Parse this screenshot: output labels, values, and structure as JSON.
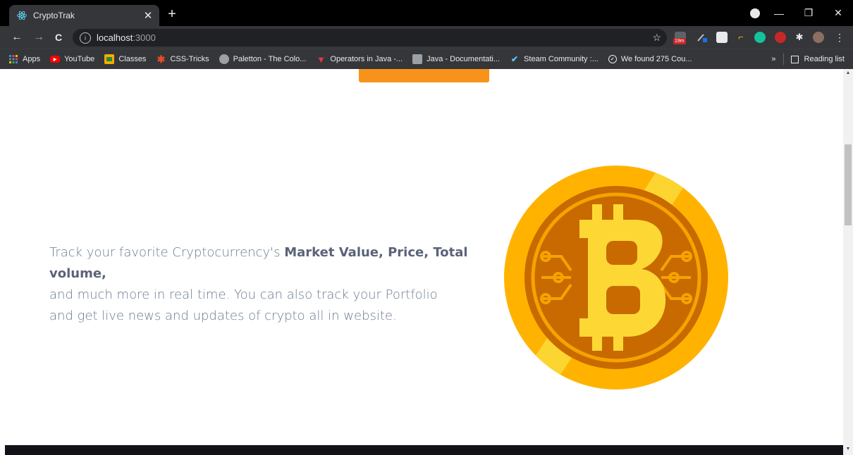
{
  "browser": {
    "tab": {
      "title": "CryptoTrak",
      "close": "✕"
    },
    "new_tab": "+",
    "window": {
      "minimize": "—",
      "restore": "❐",
      "close": "✕"
    },
    "nav": {
      "back": "←",
      "forward": "→",
      "reload": "C"
    },
    "address": {
      "host": "localhost",
      "port": ":3000",
      "info": "i",
      "star": "☆"
    },
    "extensions": {
      "badge": "19m"
    },
    "bookmarks": [
      {
        "label": "Apps",
        "icon": "apps-grid-icon",
        "color": "#4285f4"
      },
      {
        "label": "YouTube",
        "icon": "youtube-icon",
        "color": "#ff0000"
      },
      {
        "label": "Classes",
        "icon": "classroom-icon",
        "color": "#f9ab00"
      },
      {
        "label": "CSS-Tricks",
        "icon": "asterisk-icon",
        "color": "#e44d26"
      },
      {
        "label": "Paletton - The Colo...",
        "icon": "paletton-icon",
        "color": "#9aa0a6"
      },
      {
        "label": "Operators in Java -...",
        "icon": "v-icon",
        "color": "#e53935"
      },
      {
        "label": "Java - Documentati...",
        "icon": "java-doc-icon",
        "color": "#9aa0a6"
      },
      {
        "label": "Steam Community :...",
        "icon": "steam-icon",
        "color": "#66c0f4"
      },
      {
        "label": "We found 275 Cou...",
        "icon": "check-circle-icon",
        "color": "#e8eaed"
      }
    ],
    "more": "»",
    "reading_list": "Reading list"
  },
  "hero": {
    "text_intro": "Track your favorite Cryptocurrency's ",
    "text_bold": "Market Value, Price, Total volume,",
    "line2": "and much more in real time. You can also track your Portfolio",
    "line3": "and get live news and updates of crypto all in website."
  },
  "colors": {
    "accent": "#f7931a",
    "coin_outer": "#ffb300",
    "coin_inner": "#c86a00",
    "coin_symbol": "#fdd835"
  }
}
